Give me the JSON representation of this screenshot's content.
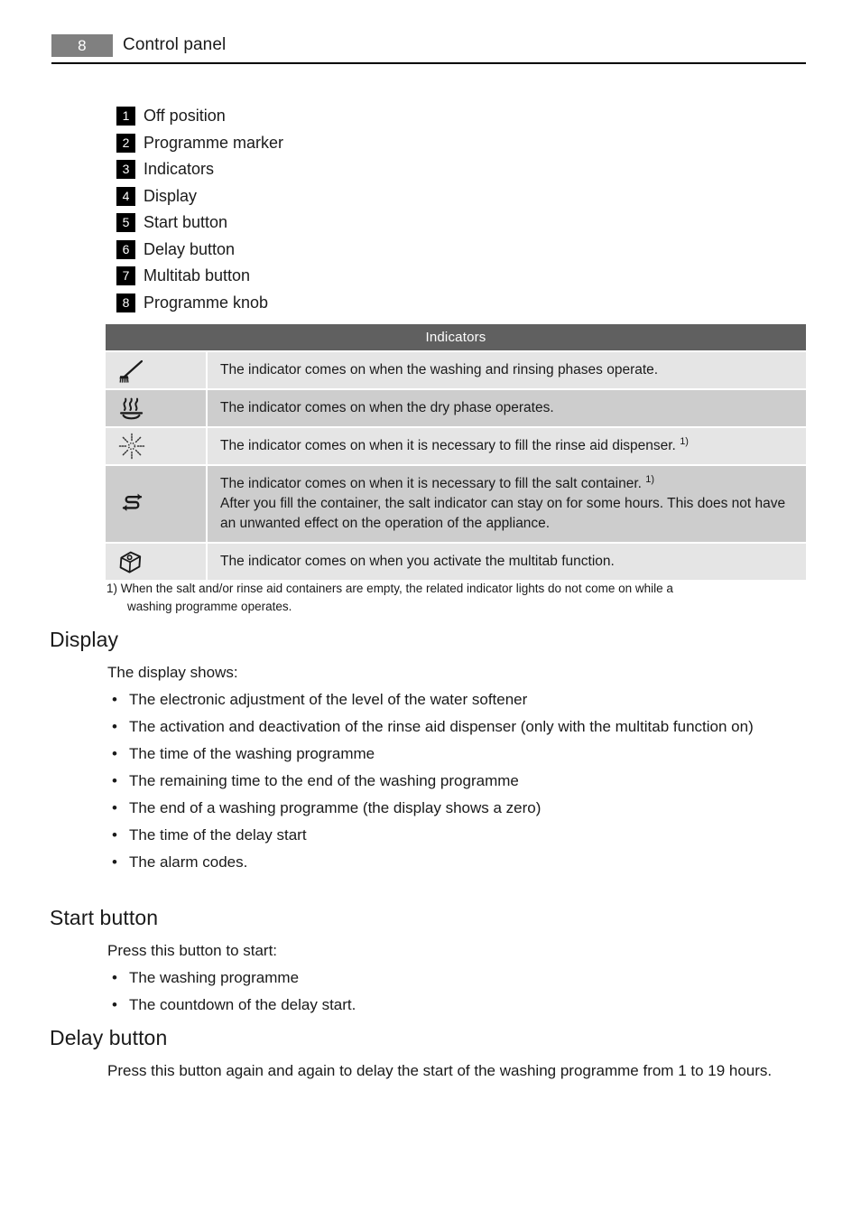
{
  "header": {
    "page_number": "8",
    "title": "Control panel"
  },
  "legend": {
    "items": [
      {
        "num": "1",
        "label": "Off position"
      },
      {
        "num": "2",
        "label": "Programme marker"
      },
      {
        "num": "3",
        "label": "Indicators"
      },
      {
        "num": "4",
        "label": "Display"
      },
      {
        "num": "5",
        "label": "Start button"
      },
      {
        "num": "6",
        "label": "Delay button"
      },
      {
        "num": "7",
        "label": "Multitab button"
      },
      {
        "num": "8",
        "label": "Programme knob"
      }
    ]
  },
  "indicators_table": {
    "header": "Indicators",
    "rows": [
      {
        "icon": "washing-brush-icon",
        "lines": [
          "The indicator comes on when the washing and rinsing phases operate."
        ],
        "footnote_marker": ""
      },
      {
        "icon": "drying-heat-icon",
        "lines": [
          "The indicator comes on when the dry phase operates."
        ],
        "footnote_marker": ""
      },
      {
        "icon": "rinse-aid-sparkle-icon",
        "lines": [
          "The indicator comes on when it is necessary to fill the rinse aid dispenser."
        ],
        "footnote_marker": "1)"
      },
      {
        "icon": "salt-arrows-icon",
        "lines": [
          "The indicator comes on when it is necessary to fill the salt container.",
          "After you fill the container, the salt indicator can stay on for some hours. This does not have an unwanted effect on the operation of the appliance."
        ],
        "footnote_marker": "1)"
      },
      {
        "icon": "multitab-tablet-icon",
        "lines": [
          "The indicator comes on when you activate the multitab function."
        ],
        "footnote_marker": ""
      }
    ]
  },
  "footnote": {
    "marker": "1)",
    "line1": "When the salt and/or rinse aid containers are empty, the related indicator lights do not come on while a",
    "line2": "washing programme operates."
  },
  "display_section": {
    "heading": "Display",
    "lead": "The display shows:",
    "bullets": [
      "The electronic adjustment of the level of the water softener",
      "The activation and deactivation of the rinse aid dispenser (only with the multitab function on)",
      "The time of the washing programme",
      "The remaining time to the end of the washing programme",
      "The end of a washing programme (the display shows a zero)",
      "The time of the delay start",
      "The alarm codes."
    ]
  },
  "start_button_section": {
    "heading": "Start button",
    "lead": "Press this button to start:",
    "bullets": [
      "The washing programme",
      "The countdown of the delay start."
    ]
  },
  "delay_button_section": {
    "heading": "Delay button",
    "paragraph": "Press this button again and again to delay the start of the washing programme from 1 to 19 hours."
  },
  "colors": {
    "page_badge": "#808080",
    "table_header": "#606060",
    "row_light": "#e5e5e5",
    "row_dark": "#cdcdcd",
    "text": "#1a1a1a"
  }
}
